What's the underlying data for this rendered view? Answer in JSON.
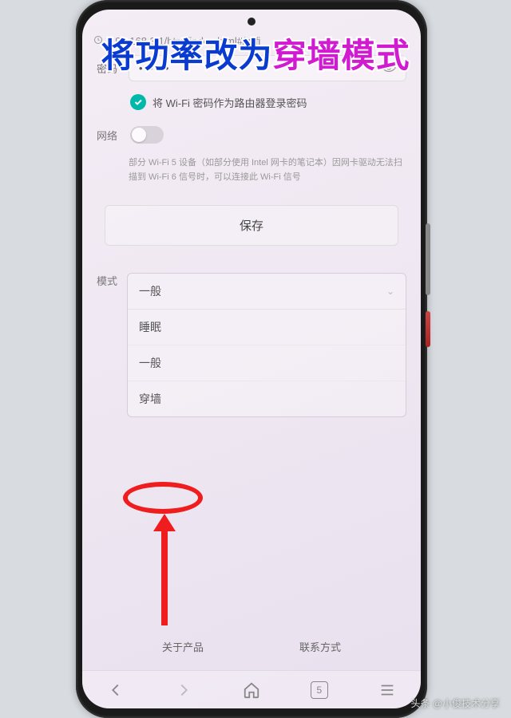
{
  "overlay": {
    "title_part1": "将功率改为",
    "title_part2": "穿墙模式"
  },
  "url_bar": {
    "url": "192.168.3.1/html/index.html#/wifi"
  },
  "password": {
    "label": "密码",
    "masked_value": "••••••"
  },
  "checkbox": {
    "label": "将 Wi-Fi 密码作为路由器登录密码"
  },
  "network": {
    "label": "网络"
  },
  "info_text": "部分 Wi-Fi 5 设备（如部分使用 Intel 网卡的笔记本）因网卡驱动无法扫描到 Wi-Fi 6 信号时，可以连接此 Wi-Fi 信号",
  "buttons": {
    "save": "保存"
  },
  "mode": {
    "label": "模式",
    "selected": "一般",
    "options": [
      "睡眠",
      "一般",
      "穿墙"
    ]
  },
  "footer": {
    "about": "关于产品",
    "contact": "联系方式"
  },
  "browser": {
    "tab_count": "5"
  },
  "watermark": "头条 @小俊技术分享"
}
